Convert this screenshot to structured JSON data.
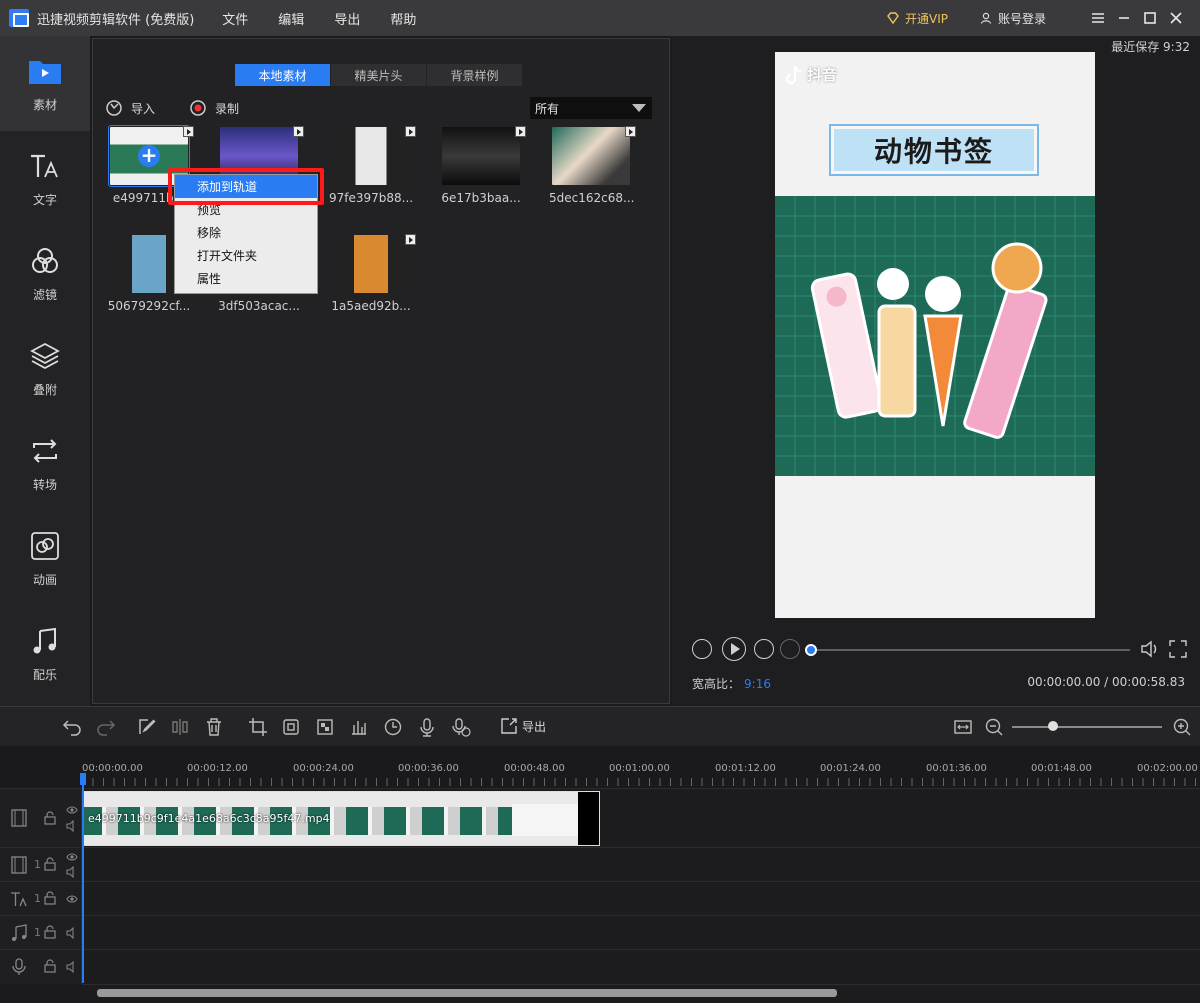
{
  "titlebar": {
    "app_title": "迅捷视频剪辑软件 (免费版)",
    "menus": [
      "文件",
      "编辑",
      "导出",
      "帮助"
    ],
    "vip_label": "开通VIP",
    "login_label": "账号登录"
  },
  "sidebar": {
    "items": [
      {
        "label": "素材",
        "icon": "folder-icon"
      },
      {
        "label": "文字",
        "icon": "text-icon"
      },
      {
        "label": "滤镜",
        "icon": "filter-icon"
      },
      {
        "label": "叠附",
        "icon": "layers-icon"
      },
      {
        "label": "转场",
        "icon": "transition-icon"
      },
      {
        "label": "动画",
        "icon": "animation-icon"
      },
      {
        "label": "配乐",
        "icon": "music-icon"
      }
    ]
  },
  "media": {
    "tabs": [
      "本地素材",
      "精美片头",
      "背景样例"
    ],
    "import_label": "导入",
    "record_label": "录制",
    "filter_value": "所有",
    "thumbnails": [
      {
        "name": "e499711b..."
      },
      {
        "name": ""
      },
      {
        "name": "97fe397b88..."
      },
      {
        "name": "6e17b3baa..."
      },
      {
        "name": "5dec162c68..."
      },
      {
        "name": "50679292cf..."
      },
      {
        "name": "3df503acac..."
      },
      {
        "name": "1a5aed92b..."
      }
    ],
    "context_menu": [
      "添加到轨道",
      "预览",
      "移除",
      "打开文件夹",
      "属性"
    ]
  },
  "preview": {
    "last_save": "最近保存 9:32",
    "watermark": "抖音",
    "banner_text": "动物书签",
    "aspect_label": "宽高比：",
    "aspect_value": "9:16",
    "time_display": "00:00:00.00 / 00:00:58.83",
    "progress": 0
  },
  "timeline": {
    "export_label": "导出",
    "ruler_labels": [
      "00:00:00.00",
      "00:00:12.00",
      "00:00:24.00",
      "00:00:36.00",
      "00:00:48.00",
      "00:01:00.00",
      "00:01:12.00",
      "00:01:24.00",
      "00:01:36.00",
      "00:01:48.00",
      "00:02:00.00"
    ],
    "clip_label": "e499711b9c9f1e4a1e68a6c3c8a95f47.mp4",
    "track_numbers": [
      "1",
      "1",
      "1"
    ]
  },
  "colors": {
    "accent": "#2a7cf3",
    "highlight_box": "#ff1a1a",
    "vip": "#f1c25a"
  }
}
